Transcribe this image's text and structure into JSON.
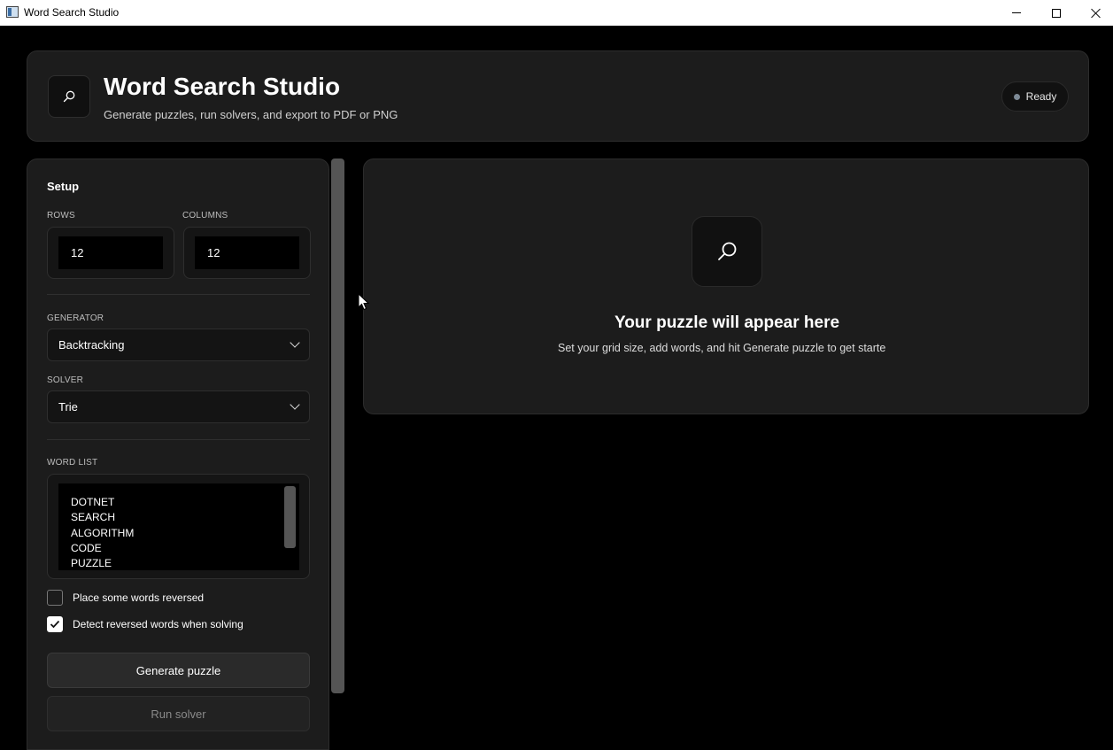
{
  "window": {
    "title": "Word Search Studio"
  },
  "header": {
    "title": "Word Search Studio",
    "subtitle": "Generate puzzles, run solvers, and export to PDF or PNG",
    "status": "Ready",
    "icon": "search-icon"
  },
  "setup": {
    "title": "Setup",
    "rows_label": "ROWS",
    "rows_value": "12",
    "columns_label": "COLUMNS",
    "columns_value": "12",
    "generator_label": "GENERATOR",
    "generator_value": "Backtracking",
    "solver_label": "SOLVER",
    "solver_value": "Trie",
    "wordlist_label": "WORD LIST",
    "words": [
      "DOTNET",
      "SEARCH",
      "ALGORITHM",
      "CODE",
      "PUZZLE"
    ],
    "option_reversed_label": "Place some words reversed",
    "option_reversed_checked": false,
    "option_detect_label": "Detect reversed words when solving",
    "option_detect_checked": true,
    "generate_label": "Generate puzzle",
    "solve_label": "Run solver"
  },
  "preview": {
    "title": "Your puzzle will appear here",
    "subtitle": "Set your grid size, add words, and hit Generate puzzle to get starte"
  },
  "colors": {
    "background": "#000000",
    "card": "#1c1c1c",
    "status_dot": "#7d8a96"
  }
}
